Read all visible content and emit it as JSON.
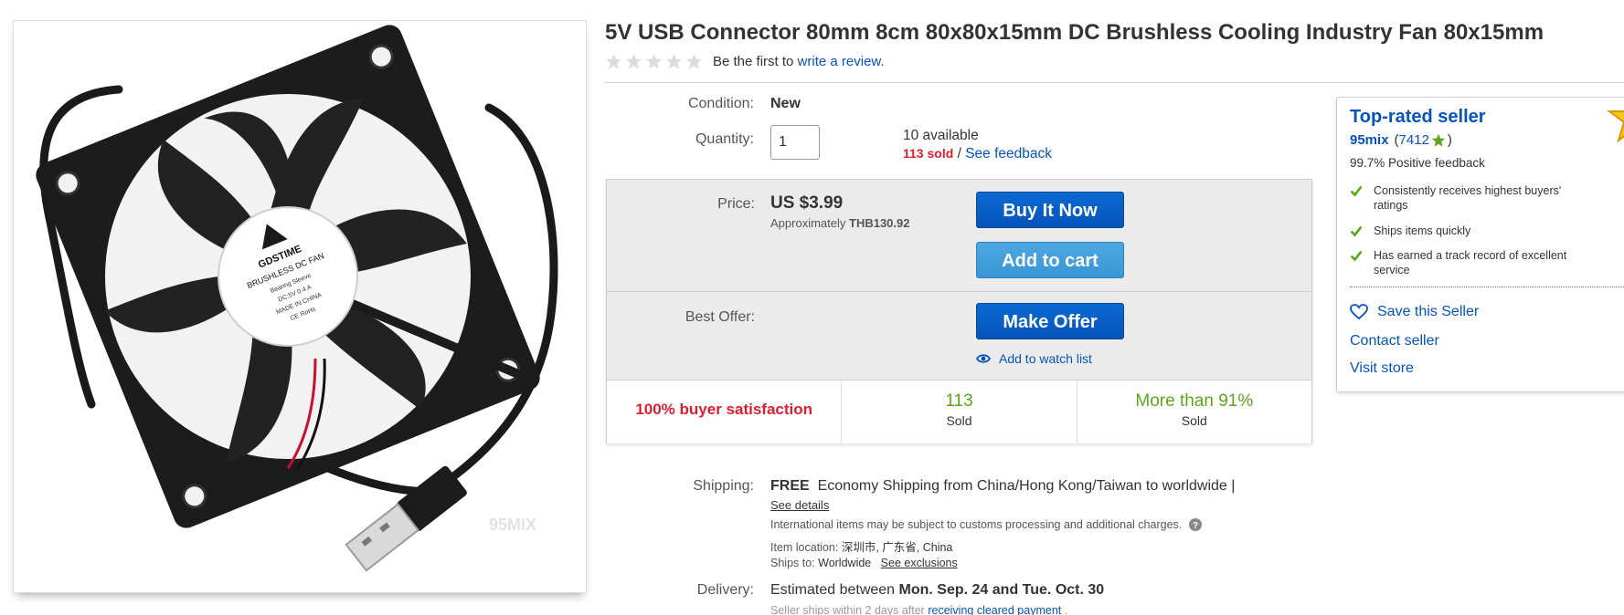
{
  "product": {
    "title": "5V USB Connector 80mm 8cm 80x80x15mm DC Brushless Cooling Industry Fan 80x15mm",
    "review_prefix": "Be the first to",
    "review_link": "write a review."
  },
  "fan_label": {
    "brand": "GDSTIME",
    "line1": "BRUSHLESS DC FAN",
    "line2": "Bearing Sleeve",
    "line3": "DC:5V  0.4 A",
    "line4": "MADE IN CHINA",
    "line5": "CE  RoHs",
    "watermark": "95MIX"
  },
  "condition": {
    "label": "Condition:",
    "value": "New"
  },
  "quantity": {
    "label": "Quantity:",
    "value": "1",
    "available": "10 available",
    "sold": "113 sold",
    "separator": "/",
    "feedback_link": "See feedback"
  },
  "price": {
    "label": "Price:",
    "value": "US $3.99",
    "approx_prefix": "Approximately",
    "approx_value": "THB130.92"
  },
  "buttons": {
    "buy_now": "Buy It Now",
    "add_to_cart": "Add to cart",
    "make_offer": "Make Offer",
    "watch": "Add to watch list"
  },
  "best_offer": {
    "label": "Best Offer:"
  },
  "stats": {
    "satisfaction": "100% buyer satisfaction",
    "sold_count": "113",
    "sold_label": "Sold",
    "percent": "More than 91%",
    "percent_label": "Sold"
  },
  "shipping": {
    "label": "Shipping:",
    "free": "FREE",
    "method": "Economy Shipping from China/Hong Kong/Taiwan to worldwide |",
    "details_link": "See details",
    "customs_note": "International items may be subject to customs processing and additional charges.",
    "location_label": "Item location:",
    "location_value": "深圳市, 广东省, China",
    "ships_to_label": "Ships to:",
    "ships_to_value": "Worldwide",
    "exclusions_link": "See exclusions"
  },
  "delivery": {
    "label": "Delivery:",
    "prefix": "Estimated between",
    "range": "Mon. Sep. 24 and Tue. Oct. 30",
    "seller_note_prefix": "Seller ships within 2 days after",
    "seller_note_link": "receiving cleared payment",
    "seller_note_suffix": "."
  },
  "seller": {
    "badge_title": "Top-rated seller",
    "name": "95mix",
    "feedback_open": "(",
    "feedback_score": "7412",
    "feedback_close": ")",
    "positive": "99.7% Positive feedback",
    "points": [
      "Consistently receives highest buyers' ratings",
      "Ships items quickly",
      "Has earned a track record of excellent service"
    ],
    "save": "Save this Seller",
    "contact": "Contact seller",
    "visit": "Visit store"
  },
  "colors": {
    "link": "#0654ba",
    "red": "#dd1e31",
    "green": "#5ba71b",
    "button_blue": "#0654ba",
    "button_light": "#3a95d3"
  },
  "icons": {
    "rating_stars": "star-icon",
    "help": "question-circle-icon",
    "check": "checkmark-icon",
    "heart": "heart-outline-icon",
    "eye": "eye-icon",
    "seller_badge": "gold-star-badge-icon"
  }
}
